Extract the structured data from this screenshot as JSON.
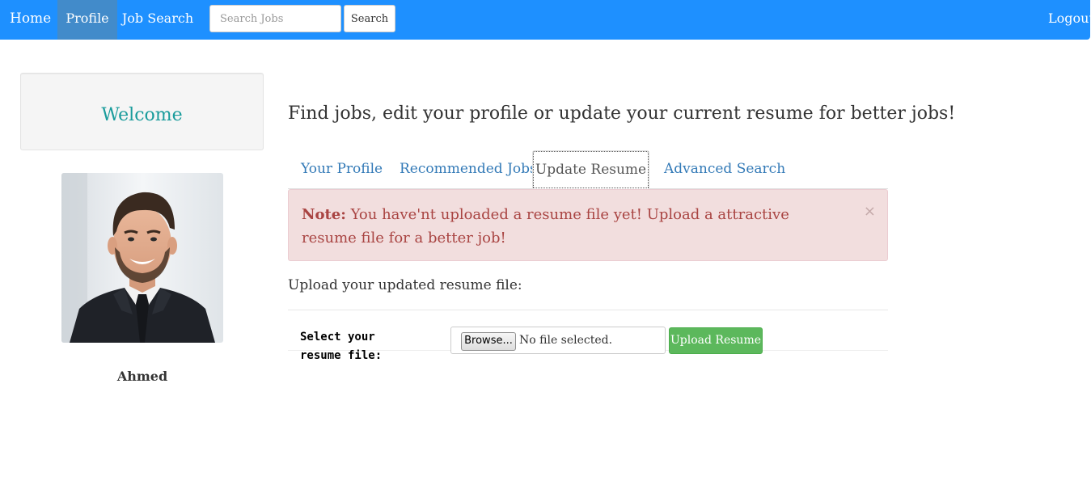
{
  "navbar": {
    "home_label": "Home",
    "profile_label": "Profile",
    "job_search_label": "Job Search",
    "search_placeholder": "Search Jobs",
    "search_button_label": "Search",
    "logout_label": "Logout",
    "background_color": "#1e90ff",
    "active_color": "#428bca"
  },
  "sidebar": {
    "welcome_text": "Welcome",
    "user_name": "Ahmed",
    "avatar_icon": "profile-photo"
  },
  "main": {
    "tagline": "Find jobs, edit your profile or update your current resume for better jobs!",
    "tabs": [
      {
        "label": "Your Profile",
        "active": false
      },
      {
        "label": "Recommended Jobs",
        "active": false
      },
      {
        "label": "Update Resume",
        "active": true
      },
      {
        "label": "Advanced Search",
        "active": false
      }
    ],
    "alert": {
      "label": "Note:",
      "message": "You have'nt uploaded a resume file yet! Upload a attractive resume file for a better job!",
      "close_symbol": "×"
    },
    "upload": {
      "heading": "Upload your updated resume file:",
      "field_label": "Select your resume file:",
      "browse_label": "Browse...",
      "file_status": "No file selected.",
      "submit_label": "Upload Resume",
      "submit_color": "#5cb85c"
    }
  }
}
